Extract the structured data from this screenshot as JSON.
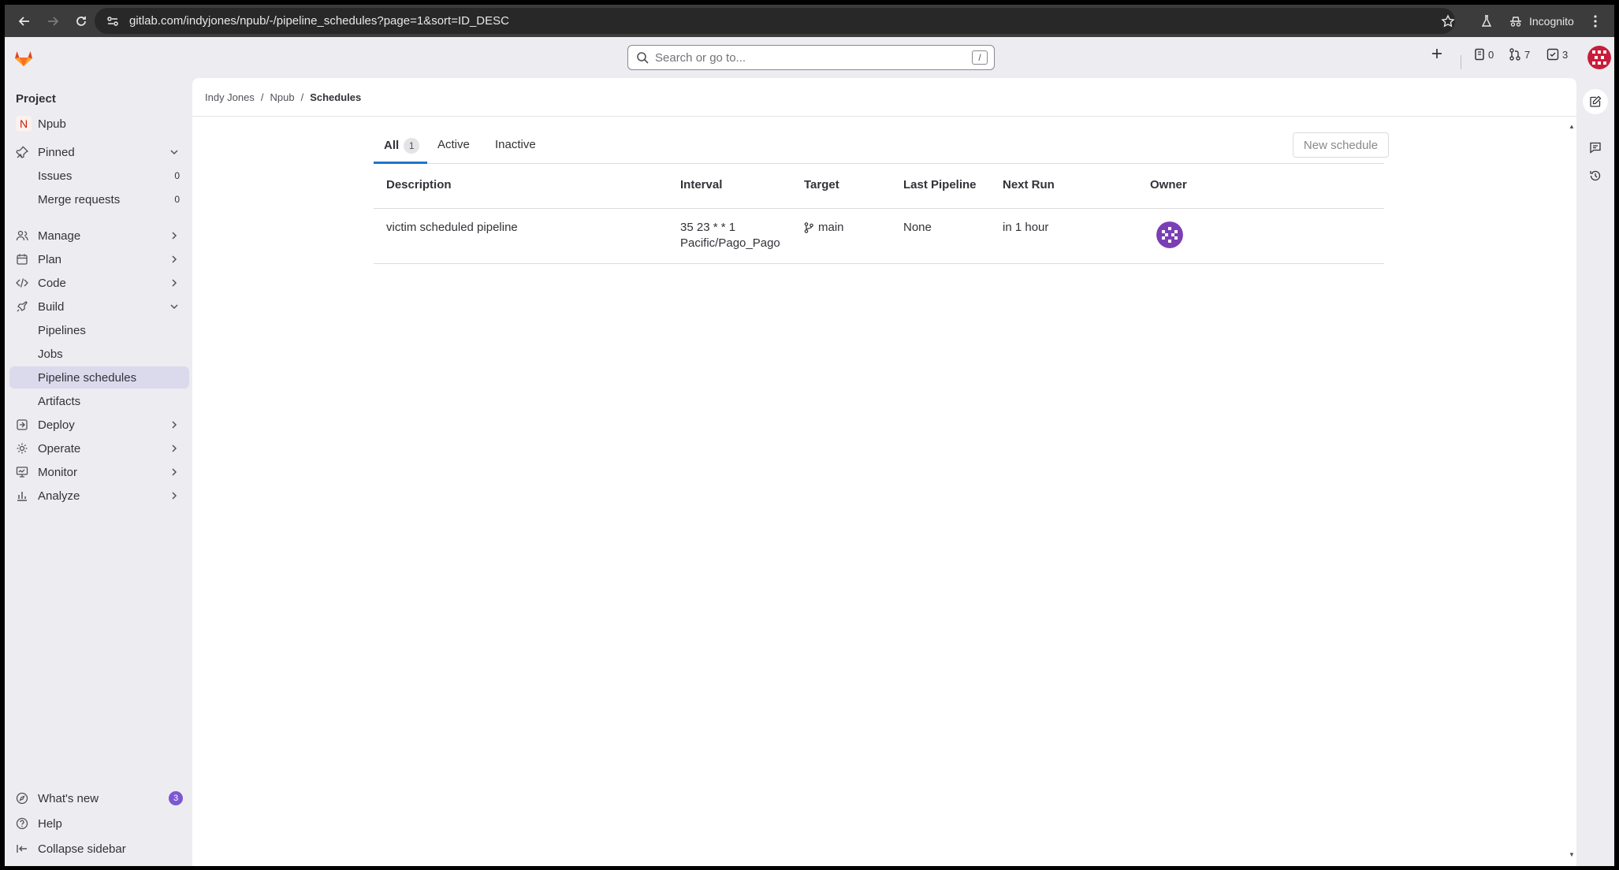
{
  "browser": {
    "url": "gitlab.com/indyjones/npub/-/pipeline_schedules?page=1&sort=ID_DESC",
    "incognito_label": "Incognito"
  },
  "topbar": {
    "search_placeholder": "Search or go to...",
    "search_shortcut": "/",
    "issues_count": "0",
    "merge_requests_count": "7",
    "todos_count": "3"
  },
  "sidebar": {
    "section_title": "Project",
    "project_name": "Npub",
    "project_initial": "N",
    "pinned_label": "Pinned",
    "pinned_items": [
      {
        "label": "Issues",
        "count": "0"
      },
      {
        "label": "Merge requests",
        "count": "0"
      }
    ],
    "groups": [
      {
        "label": "Manage"
      },
      {
        "label": "Plan"
      },
      {
        "label": "Code"
      },
      {
        "label": "Build"
      }
    ],
    "build_items": [
      {
        "label": "Pipelines"
      },
      {
        "label": "Jobs"
      },
      {
        "label": "Pipeline schedules"
      },
      {
        "label": "Artifacts"
      }
    ],
    "more_groups": [
      {
        "label": "Deploy"
      },
      {
        "label": "Operate"
      },
      {
        "label": "Monitor"
      },
      {
        "label": "Analyze"
      }
    ],
    "whats_new_label": "What's new",
    "whats_new_count": "3",
    "help_label": "Help",
    "collapse_label": "Collapse sidebar"
  },
  "breadcrumb": {
    "items": [
      "Indy Jones",
      "Npub",
      "Schedules"
    ],
    "separator": "/"
  },
  "tabs": [
    {
      "label": "All",
      "count": "1"
    },
    {
      "label": "Active"
    },
    {
      "label": "Inactive"
    }
  ],
  "new_schedule_label": "New schedule",
  "table": {
    "headers": [
      "Description",
      "Interval",
      "Target",
      "Last Pipeline",
      "Next Run",
      "Owner"
    ],
    "rows": [
      {
        "description": "victim scheduled pipeline",
        "interval_line1": "35 23 * * 1",
        "interval_line2": "Pacific/Pago_Pago",
        "target": "main",
        "last_pipeline": "None",
        "next_run": "in 1 hour"
      }
    ]
  },
  "colors": {
    "accent": "#1f75cb",
    "active_nav": "#dbd9ec",
    "badge": "#7b58cf",
    "avatar": "#7b3fb5"
  }
}
